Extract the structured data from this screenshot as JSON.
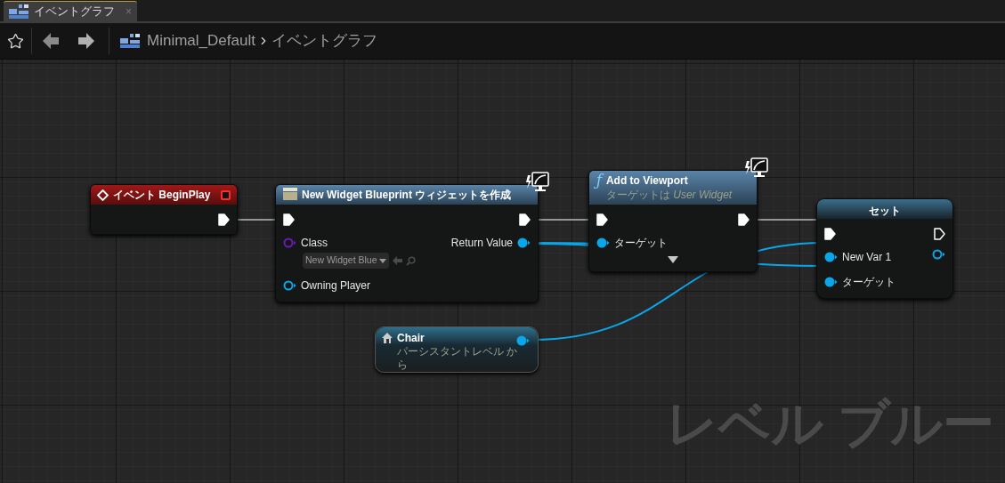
{
  "tab": {
    "title": "イベントグラフ",
    "close": "×",
    "selected": true
  },
  "toolbar": {
    "breadcrumb": [
      {
        "label": "Minimal_Default"
      },
      {
        "label": "イベントグラフ"
      }
    ]
  },
  "nodes": [
    {
      "kind": "event",
      "title": "イベント BeginPlay",
      "rows": [
        {
          "right": {
            "kind": "exec",
            "connected": true
          }
        }
      ]
    },
    {
      "kind": "function",
      "title": "New Widget Blueprint ウィジェットを作成",
      "badge": true,
      "rows": [
        {
          "left": {
            "kind": "exec",
            "connected": true
          },
          "right": {
            "kind": "exec",
            "connected": true
          }
        },
        {
          "left": {
            "kind": "data",
            "label": "Class",
            "connected": false,
            "color": "#6a1bb5",
            "value": "New Widget Blue"
          },
          "right": {
            "kind": "data",
            "label": "Return Value",
            "connected": true,
            "color": "#0aa6ea"
          }
        },
        {
          "left": {
            "kind": "data",
            "label": "Owning Player",
            "connected": false,
            "color": "#0aa6ea"
          }
        }
      ]
    },
    {
      "kind": "function",
      "icon_glyph": "ƒ",
      "title": "Add to Viewport",
      "subtitle": "ターゲットは *User Widget*",
      "badge": true,
      "expandable": true,
      "rows": [
        {
          "left": {
            "kind": "exec",
            "connected": true
          },
          "right": {
            "kind": "exec",
            "connected": true
          }
        },
        {
          "left": {
            "kind": "data",
            "label": "ターゲット",
            "connected": true,
            "color": "#0aa6ea"
          }
        }
      ]
    },
    {
      "kind": "set",
      "title": "セット",
      "rows": [
        {
          "left": {
            "kind": "exec",
            "connected": true
          },
          "right": {
            "kind": "exec",
            "connected": false
          }
        },
        {
          "left": {
            "kind": "data",
            "label": "New Var 1",
            "connected": true,
            "color": "#0aa6ea"
          },
          "right": {
            "kind": "data",
            "connected": false,
            "color": "#0aa6ea"
          }
        },
        {
          "left": {
            "kind": "data",
            "label": "ターゲット",
            "connected": true,
            "color": "#0aa6ea"
          }
        }
      ]
    },
    {
      "kind": "variable",
      "title": "Chair",
      "subtitle": "パーシスタントレベル から",
      "rows": [
        {
          "right": {
            "kind": "data",
            "connected": true,
            "color": "#0aa6ea"
          }
        }
      ]
    }
  ],
  "watermark": "レベル ブルー"
}
